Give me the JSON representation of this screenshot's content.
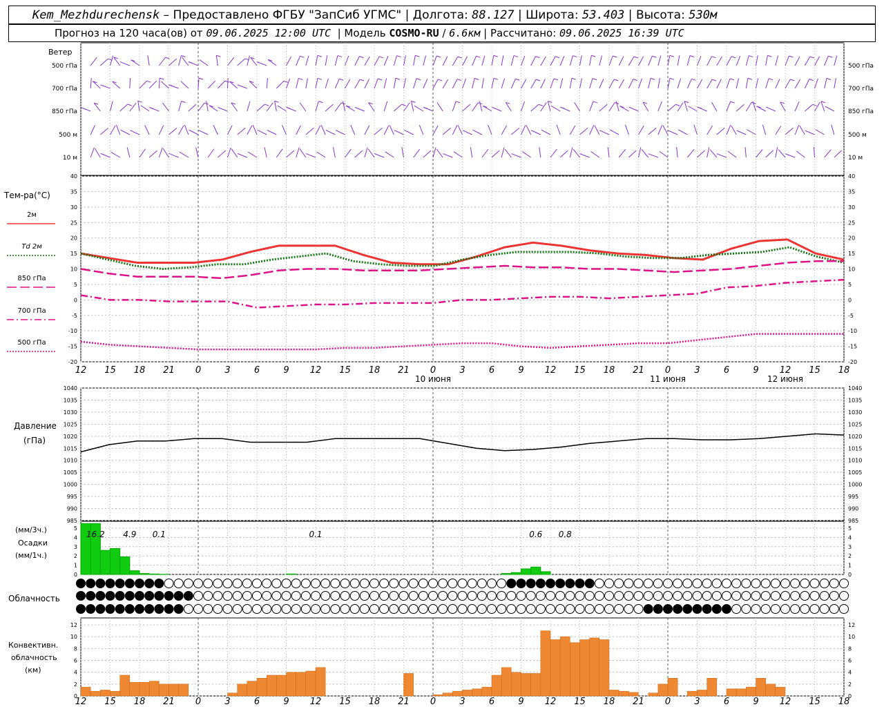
{
  "header": {
    "station": "Kem_Mezhdurechensk",
    "provided_by": "– Предоставлено ФГБУ \"ЗапСиб УГМС\"",
    "lon_label": "Долгота:",
    "lon": "88.127",
    "lat_label": "Широта:",
    "lat": "53.403",
    "alt_label": "Высота:",
    "alt": "530м",
    "forecast_label": "Прогноз на 120 часа(ов)  от",
    "forecast_time": "09.06.2025 12:00 UTC",
    "model_label": "Модель",
    "model": "COSMO-RU",
    "model_res": "6.6км",
    "calc_label": "Рассчитано:",
    "calc_time": "09.06.2025 16:39 UTC"
  },
  "wind_panel": {
    "title": "Ветер",
    "levels": [
      "500 гПа",
      "700 гПа",
      "850 гПа",
      "500 м",
      "10 м"
    ]
  },
  "temp_panel": {
    "title": "Тем-ра(°С)",
    "legend": [
      {
        "label": "2м",
        "color": "#ee3333",
        "dash": "solid"
      },
      {
        "label": "Td  2м",
        "color": "#117711",
        "dash": "dotted"
      },
      {
        "label": "850 гПа",
        "color": "#dd1188",
        "dash": "long-dash"
      },
      {
        "label": "700 гПа",
        "color": "#dd1188",
        "dash": "dash-dot"
      },
      {
        "label": "500 гПа",
        "color": "#dd1188",
        "dash": "dotted"
      }
    ],
    "y_ticks": [
      "40",
      "35",
      "30",
      "25",
      "20",
      "15",
      "10",
      "5",
      "0",
      "-5",
      "-10",
      "-15",
      "-20"
    ]
  },
  "time_axis": {
    "hour_labels": [
      "12",
      "15",
      "18",
      "21",
      "0",
      "3",
      "6",
      "9",
      "12",
      "15",
      "18",
      "21",
      "0",
      "3",
      "6",
      "9",
      "12",
      "15",
      "18",
      "21",
      "0",
      "3",
      "6",
      "9",
      "12",
      "15",
      "18"
    ],
    "date_labels": [
      "10 июня",
      "11 июня",
      "12 июня"
    ]
  },
  "pressure_panel": {
    "title_line1": "Давление",
    "title_line2": "(гПа)",
    "y_ticks": [
      "1040",
      "1035",
      "1030",
      "1025",
      "1020",
      "1015",
      "1010",
      "1005",
      "1000",
      "995",
      "990",
      "985"
    ]
  },
  "precip_panel": {
    "title_line1": "(мм/3ч.)",
    "title_line2": "Осадки",
    "title_line3": "(мм/1ч.)",
    "y_ticks": [
      "5",
      "4",
      "3",
      "2",
      "1",
      "0"
    ],
    "annotations": [
      "16.2",
      "4.9",
      "0.1",
      "0.1",
      "0.6",
      "0.8"
    ]
  },
  "cloud_panel": {
    "title": "Облачность"
  },
  "conv_panel": {
    "title_line1": "Конвективн.",
    "title_line2": "облачность",
    "title_line3": "(км)",
    "y_ticks": [
      "12",
      "10",
      "8",
      "6",
      "4",
      "2",
      "0"
    ]
  },
  "chart_data": [
    {
      "type": "line",
      "title": "Тем-ра(°С)",
      "x_hours": [
        0,
        3,
        6,
        9,
        12,
        15,
        18,
        21,
        24,
        27,
        30,
        33,
        36,
        39,
        42,
        45,
        48,
        51,
        54,
        57,
        60,
        63,
        66,
        69,
        72,
        75,
        78
      ],
      "ylim": [
        -20,
        40
      ],
      "series": [
        {
          "name": "2м",
          "values": [
            15,
            13.5,
            12,
            12,
            12,
            13,
            15.5,
            17.5,
            17.5,
            17.5,
            14.5,
            12,
            11.5,
            11.5,
            14,
            17,
            18.5,
            17.5,
            16,
            15,
            14.5,
            13.5,
            13,
            16.5,
            19,
            19.5,
            15,
            13
          ]
        },
        {
          "name": "Td  2м",
          "values": [
            15,
            13,
            11,
            10,
            10.5,
            11.5,
            11.5,
            13,
            14,
            15,
            12.5,
            11.5,
            11,
            11,
            13,
            14.5,
            15.5,
            15.5,
            15.5,
            15,
            14,
            13.5,
            13.5,
            14.5,
            15,
            15.5,
            17,
            14,
            12
          ]
        },
        {
          "name": "850 гПа",
          "values": [
            10,
            8.5,
            7.5,
            7.5,
            7.5,
            7,
            8,
            9.5,
            10,
            10,
            9.5,
            9.5,
            9.5,
            10,
            10.5,
            11,
            10.5,
            10.5,
            10,
            10,
            9.5,
            9,
            9.5,
            10,
            11,
            12,
            12.5,
            12.5
          ]
        },
        {
          "name": "700 гПа",
          "values": [
            1.5,
            0,
            0,
            -0.5,
            -0.5,
            -0.5,
            -2.5,
            -2,
            -1.5,
            -1.5,
            -1,
            -1,
            -1,
            0,
            0,
            0.5,
            1,
            1,
            0.5,
            1,
            1.5,
            2,
            4,
            4.5,
            5.5,
            6,
            6.5
          ]
        },
        {
          "name": "500 гПа",
          "values": [
            -13.5,
            -14.5,
            -15,
            -15.5,
            -16,
            -16,
            -16,
            -16,
            -16,
            -15.5,
            -15.5,
            -15,
            -14.5,
            -14,
            -14,
            -15,
            -15.5,
            -15,
            -14.5,
            -14,
            -14,
            -13,
            -12,
            -11,
            -11,
            -11,
            -11
          ]
        }
      ]
    },
    {
      "type": "line",
      "title": "Давление (гПа)",
      "ylim": [
        985,
        1040
      ],
      "series": [
        {
          "name": "",
          "values": [
            1013.5,
            1016.5,
            1018,
            1018,
            1019,
            1019,
            1017.5,
            1017.5,
            1017.5,
            1019,
            1019,
            1019,
            1019,
            1017,
            1015,
            1014,
            1014.5,
            1015.5,
            1017,
            1018,
            1019,
            1019,
            1018.5,
            1018.5,
            1019,
            1020,
            1021,
            1020.5
          ]
        }
      ]
    },
    {
      "type": "bar",
      "title": "Осадки",
      "ylim": [
        0,
        5
      ],
      "x_hours": [
        0,
        1,
        2,
        3,
        4,
        5,
        6,
        7,
        8,
        21,
        43,
        44,
        45,
        46,
        47
      ],
      "values": [
        5.5,
        5.5,
        2.6,
        2.8,
        1.9,
        0.4,
        0.1,
        0.05,
        0.02,
        0.05,
        0.1,
        0.2,
        0.6,
        0.8,
        0.3
      ]
    },
    {
      "type": "bar",
      "title": "Конвективн. облачность (км)",
      "ylim": [
        0,
        13
      ],
      "x_hours": [
        0,
        1,
        2,
        3,
        4,
        5,
        6,
        7,
        8,
        9,
        10,
        15,
        16,
        17,
        18,
        19,
        20,
        21,
        22,
        23,
        24,
        33,
        36,
        37,
        38,
        39,
        40,
        41,
        42,
        43,
        44,
        45,
        46,
        47,
        48,
        49,
        50,
        51,
        52,
        53,
        54,
        55,
        56,
        58,
        59,
        60,
        62,
        63,
        64,
        66,
        67,
        68,
        69,
        70,
        71
      ],
      "values": [
        1.5,
        0.8,
        1,
        0.8,
        3.5,
        2.3,
        2.3,
        2.5,
        2,
        2,
        2,
        0.5,
        2,
        2.5,
        3,
        3.5,
        3.5,
        4,
        4,
        4.2,
        4.8,
        3.8,
        0.2,
        0.5,
        0.8,
        1,
        1.2,
        1.5,
        3.5,
        4.8,
        4,
        3.8,
        3.8,
        11,
        9.5,
        10,
        9,
        9.5,
        9.8,
        9.5,
        1,
        0.8,
        0.6,
        0.5,
        2,
        3,
        0.8,
        1,
        3,
        1.2,
        1.2,
        1.5,
        3,
        2,
        1.5,
        0.5
      ]
    }
  ]
}
